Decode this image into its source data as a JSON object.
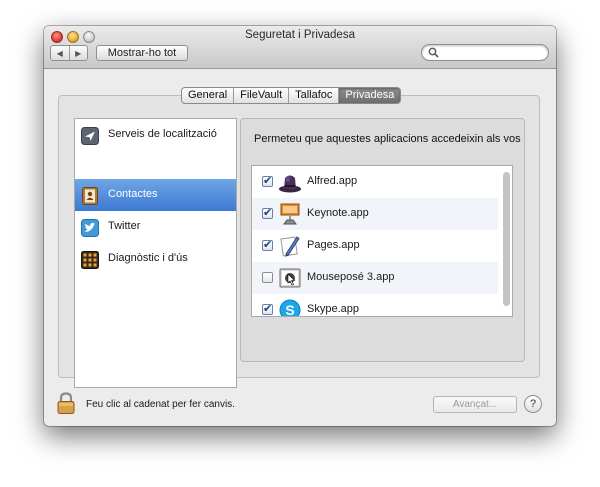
{
  "window": {
    "title": "Seguretat i Privadesa",
    "nav_back": "◀",
    "nav_forward": "▶",
    "show_all": "Mostrar-ho tot",
    "search": {
      "placeholder": "",
      "value": ""
    }
  },
  "tabs": [
    {
      "label": "General",
      "active": false
    },
    {
      "label": "FileVault",
      "active": false
    },
    {
      "label": "Tallafoc",
      "active": false
    },
    {
      "label": "Privadesa",
      "active": true
    }
  ],
  "sidebar": {
    "items": [
      {
        "label": "Serveis de localització",
        "icon": "location-arrow-icon",
        "selected": false
      },
      {
        "label": "Contactes",
        "icon": "contacts-book-icon",
        "selected": true
      },
      {
        "label": "Twitter",
        "icon": "twitter-bird-icon",
        "selected": false
      },
      {
        "label": "Diagnòstic i d'ús",
        "icon": "diagnostics-icon",
        "selected": false
      }
    ]
  },
  "panel": {
    "description": "Permeteu que aquestes aplicacions accedeixin als vos",
    "apps": [
      {
        "name": "Alfred.app",
        "checked": true,
        "icon": "alfred-hat-icon"
      },
      {
        "name": "Keynote.app",
        "checked": true,
        "icon": "keynote-podium-icon"
      },
      {
        "name": "Pages.app",
        "checked": true,
        "icon": "pages-pen-icon"
      },
      {
        "name": "Mouseposé 3.app",
        "checked": false,
        "icon": "mousepose-cursor-icon"
      },
      {
        "name": "Skype.app",
        "checked": true,
        "icon": "skype-icon"
      }
    ]
  },
  "footer": {
    "lock_text": "Feu clic al cadenat per fer canvis.",
    "advanced_button": "Avançat...",
    "help_button": "?"
  },
  "colors": {
    "selection": "#3c79d1",
    "checkmark": "#1d3d7a",
    "window_bg": "#ececec"
  }
}
